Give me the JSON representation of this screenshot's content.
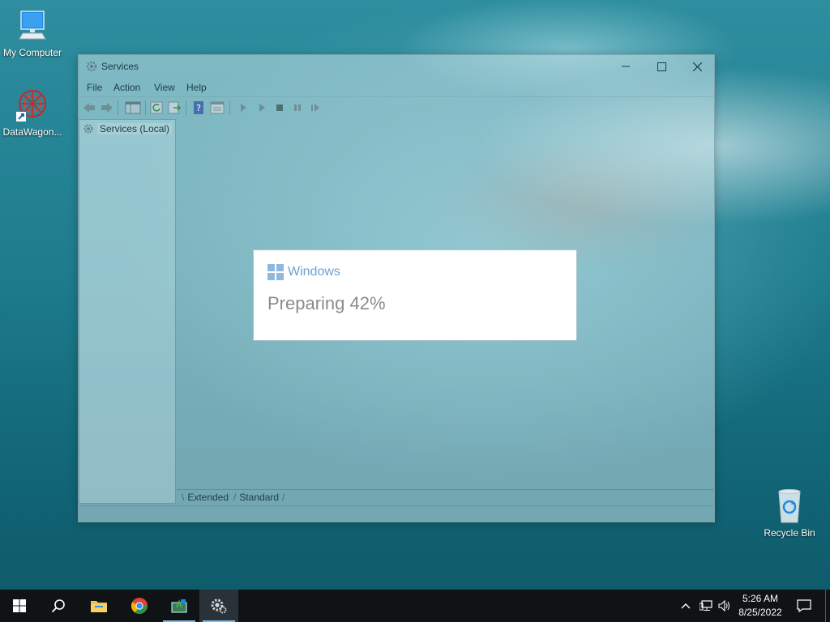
{
  "desktop": {
    "icons": [
      {
        "label": "My Computer",
        "icon": "monitor-icon"
      },
      {
        "label": "DataWagon...",
        "icon": "datawagon-icon"
      },
      {
        "label": "Recycle Bin",
        "icon": "recycle-bin-icon"
      }
    ]
  },
  "window": {
    "title": "Services",
    "menu": [
      "File",
      "Action",
      "View",
      "Help"
    ],
    "toolbar": [
      "back-icon",
      "forward-icon",
      "show-hide-console-tree-icon",
      "refresh-icon",
      "export-list-icon",
      "help-icon",
      "properties-icon",
      "start-service-icon",
      "start-service-alt-icon",
      "stop-service-icon",
      "pause-service-icon",
      "restart-service-icon"
    ],
    "tree": {
      "root_label": "Services (Local)"
    },
    "tabs": [
      "Extended",
      "Standard"
    ]
  },
  "dialog": {
    "brand": "Windows",
    "status": "Preparing 42%",
    "progress_percent": 42
  },
  "taskbar": {
    "pinned": [
      "start-icon",
      "search-icon",
      "file-explorer-icon",
      "chrome-icon",
      "network-tool-icon",
      "services-icon"
    ],
    "clock": {
      "time": "5:26 AM",
      "date": "8/25/2022"
    }
  },
  "colors": {
    "brand_blue": "#6aa2d2",
    "status_gray": "#8b8b8b",
    "taskbar": "#0f1316",
    "active_underline": "#76b9ed"
  }
}
